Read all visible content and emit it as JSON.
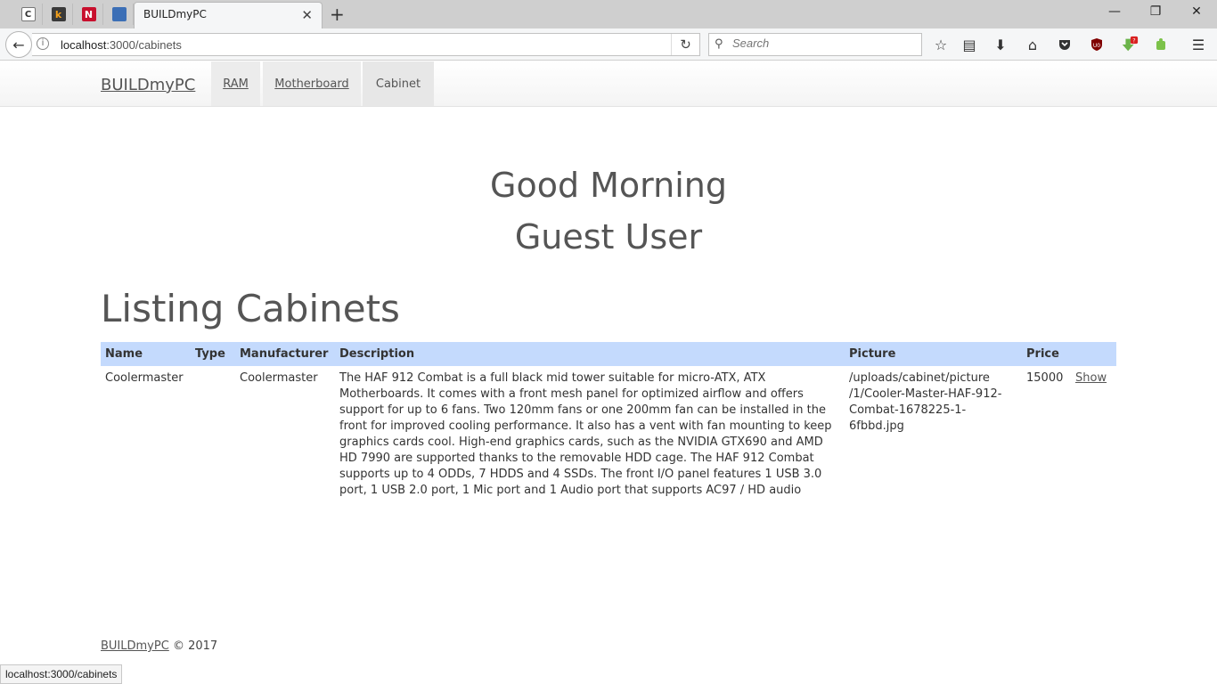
{
  "browser": {
    "tab_title": "BUILDmyPC",
    "url_host": "localhost",
    "url_path": ":3000/cabinets",
    "search_placeholder": "Search",
    "status_url": "localhost:3000/cabinets",
    "badge_count": "?"
  },
  "nav": {
    "brand": "BUILDmyPC",
    "links": [
      "RAM",
      "Motherboard",
      "Cabinet"
    ]
  },
  "greeting": {
    "line1": "Good Morning",
    "line2": "Guest User"
  },
  "heading": "Listing Cabinets",
  "table": {
    "headers": [
      "Name",
      "Type",
      "Manufacturer",
      "Description",
      "Picture",
      "Price"
    ],
    "rows": [
      {
        "name": "Coolermaster",
        "type": "",
        "manufacturer": "Coolermaster",
        "description": "The HAF 912 Combat is a full black mid tower suitable for micro-ATX, ATX Motherboards. It comes with a front mesh panel for optimized airflow and offers support for up to 6 fans. Two 120mm fans or one 200mm fan can be installed in the front for improved cooling performance. It also has a vent with fan mounting to keep graphics cards cool. High-end graphics cards, such as the NVIDIA GTX690 and AMD HD 7990 are supported thanks to the removable HDD cage. The HAF 912 Combat supports up to 4 ODDs, 7 HDDS and 4 SSDs. The front I/O panel features 1 USB 3.0 port, 1 USB 2.0 port, 1 Mic port and 1 Audio port that supports AC97 / HD audio",
        "picture": "/uploads/cabinet/picture /1/Cooler-Master-HAF-912-Combat-1678225-1-6fbbd.jpg",
        "price": "15000",
        "action": "Show"
      }
    ]
  },
  "footer": {
    "brand": "BUILDmyPC",
    "copyright": "© 2017"
  },
  "colors": {
    "table_header_bg": "#c4dafd",
    "text": "#555555"
  }
}
